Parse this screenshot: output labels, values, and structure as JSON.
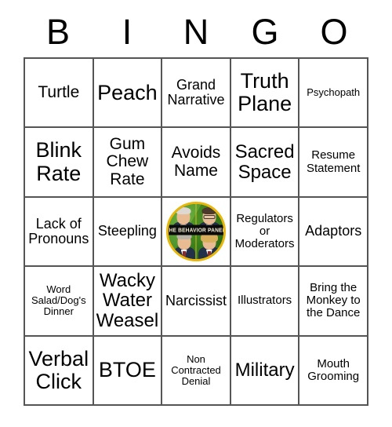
{
  "header": {
    "letters": [
      "B",
      "I",
      "N",
      "G",
      "O"
    ]
  },
  "colors": {
    "grid_border": "#555555",
    "cell_background": "#ffffff",
    "text": "#000000",
    "logo_ring": "#e8b60c",
    "logo_background": "#3f8a1e",
    "logo_banner_background": "#0b0b0b",
    "logo_banner_text": "#f7f2d8"
  },
  "free_space": {
    "type": "logo-image",
    "banner_text": "THE BEHAVIOR PANEL",
    "panelists": [
      {
        "position": "top-left",
        "hair": "white"
      },
      {
        "position": "top-right",
        "hair": "dark",
        "glasses": true
      },
      {
        "position": "bottom-left",
        "hair": "gray"
      },
      {
        "position": "bottom-right",
        "hair": "blond"
      }
    ]
  },
  "grid": {
    "rows": [
      [
        {
          "label": "Turtle",
          "size": "lg"
        },
        {
          "label": "Peach",
          "size": "xxl"
        },
        {
          "label": "Grand\nNarrative",
          "size": "md"
        },
        {
          "label": "Truth\nPlane",
          "size": "xxl"
        },
        {
          "label": "Psychopath",
          "size": "xs"
        }
      ],
      [
        {
          "label": "Blink\nRate",
          "size": "xxl"
        },
        {
          "label": "Gum\nChew\nRate",
          "size": "lg"
        },
        {
          "label": "Avoids\nName",
          "size": "lg"
        },
        {
          "label": "Sacred\nSpace",
          "size": "xl"
        },
        {
          "label": "Resume\nStatement",
          "size": "sm"
        }
      ],
      [
        {
          "label": "Lack of\nPronouns",
          "size": "md"
        },
        {
          "label": "Steepling",
          "size": "md"
        },
        {
          "label": "",
          "size": "md",
          "free": true
        },
        {
          "label": "Regulators\nor\nModerators",
          "size": "sm"
        },
        {
          "label": "Adaptors",
          "size": "md"
        }
      ],
      [
        {
          "label": "Word\nSalad/Dog's\nDinner",
          "size": "xs"
        },
        {
          "label": "Wacky\nWater\nWeasel",
          "size": "xl"
        },
        {
          "label": "Narcissist",
          "size": "md"
        },
        {
          "label": "Illustrators",
          "size": "sm"
        },
        {
          "label": "Bring the\nMonkey to\nthe Dance",
          "size": "sm"
        }
      ],
      [
        {
          "label": "Verbal\nClick",
          "size": "xxl"
        },
        {
          "label": "BTOE",
          "size": "xxl"
        },
        {
          "label": "Non\nContracted\nDenial",
          "size": "xs"
        },
        {
          "label": "Military",
          "size": "xl"
        },
        {
          "label": "Mouth\nGrooming",
          "size": "sm"
        }
      ]
    ]
  }
}
